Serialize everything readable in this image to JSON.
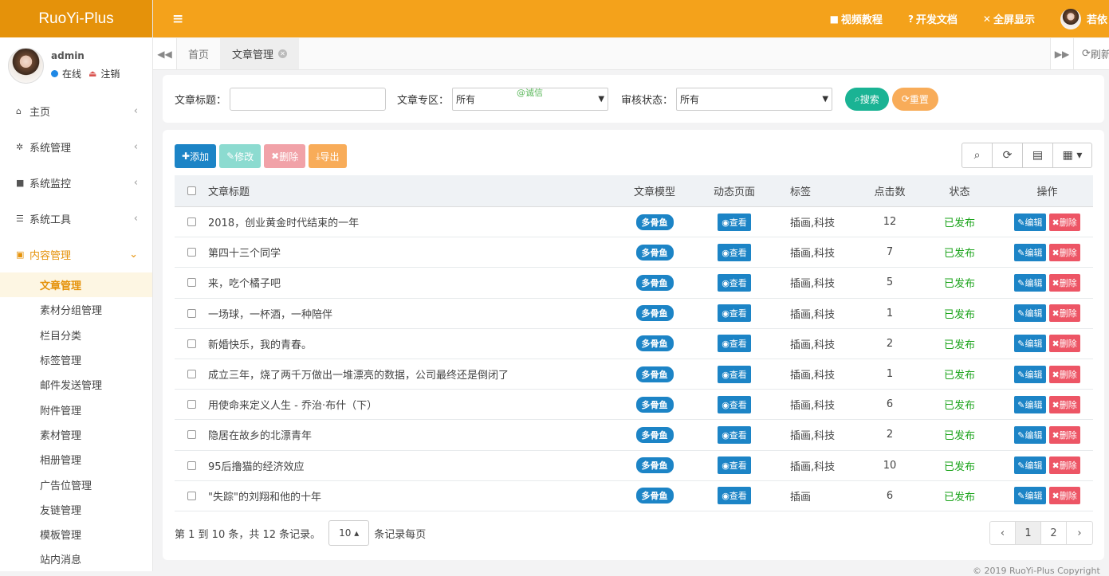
{
  "app": {
    "title": "RuoYi-Plus"
  },
  "user": {
    "name": "admin",
    "status": "在线",
    "logout": "注销"
  },
  "sidebar": {
    "items": [
      {
        "icon": "home-icon",
        "label": "主页"
      },
      {
        "icon": "gear-icon",
        "label": "系统管理"
      },
      {
        "icon": "video-icon",
        "label": "系统监控"
      },
      {
        "icon": "bars-icon",
        "label": "系统工具"
      },
      {
        "icon": "content-icon",
        "label": "内容管理"
      }
    ],
    "sub_items": [
      "文章管理",
      "素材分组管理",
      "栏目分类",
      "标签管理",
      "邮件发送管理",
      "附件管理",
      "素材管理",
      "相册管理",
      "广告位管理",
      "友链管理",
      "模板管理",
      "站内消息"
    ]
  },
  "header": {
    "links": [
      "视频教程",
      "开发文档",
      "全屏显示"
    ],
    "user": "若依"
  },
  "tabs": {
    "items": [
      "首页",
      "文章管理"
    ],
    "refresh": "刷新"
  },
  "search": {
    "title_label": "文章标题：",
    "zone_label": "文章专区：",
    "zone_value": "所有",
    "watermark": "@诚信",
    "status_label": "审核状态：",
    "status_value": "所有",
    "search_btn": "搜索",
    "reset_btn": "重置"
  },
  "toolbar": {
    "add": "添加",
    "edit": "修改",
    "delete": "删除",
    "export": "导出"
  },
  "table": {
    "headers": [
      "文章标题",
      "文章模型",
      "动态页面",
      "标签",
      "点击数",
      "状态",
      "操作"
    ],
    "model_badge": "多骨鱼",
    "view_label": "查看",
    "edit_label": "编辑",
    "delete_label": "删除",
    "rows": [
      {
        "title": "2018，创业黄金时代结束的一年",
        "tags": "插画,科技",
        "clicks": "12",
        "status": "已发布"
      },
      {
        "title": "第四十三个同学",
        "tags": "插画,科技",
        "clicks": "7",
        "status": "已发布"
      },
      {
        "title": "来，吃个橘子吧",
        "tags": "插画,科技",
        "clicks": "5",
        "status": "已发布"
      },
      {
        "title": "一场球，一杯酒，一种陪伴",
        "tags": "插画,科技",
        "clicks": "1",
        "status": "已发布"
      },
      {
        "title": "新婚快乐，我的青春。",
        "tags": "插画,科技",
        "clicks": "2",
        "status": "已发布"
      },
      {
        "title": "成立三年，烧了两千万做出一堆漂亮的数据，公司最终还是倒闭了",
        "tags": "插画,科技",
        "clicks": "1",
        "status": "已发布"
      },
      {
        "title": "用使命来定义人生 - 乔治·布什（下）",
        "tags": "插画,科技",
        "clicks": "6",
        "status": "已发布"
      },
      {
        "title": "隐居在故乡的北漂青年",
        "tags": "插画,科技",
        "clicks": "2",
        "status": "已发布"
      },
      {
        "title": "95后撸猫的经济效应",
        "tags": "插画,科技",
        "clicks": "10",
        "status": "已发布"
      },
      {
        "title": "\"失踪\"的刘翔和他的十年",
        "tags": "插画",
        "clicks": "6",
        "status": "已发布"
      }
    ]
  },
  "pagination": {
    "summary": "第 1 到 10 条，共 12 条记录。",
    "page_size": "10",
    "per_page": "条记录每页",
    "pages": [
      "‹",
      "1",
      "2",
      "›"
    ]
  },
  "footer": {
    "copyright": "© 2019 RuoYi-Plus Copyright"
  }
}
